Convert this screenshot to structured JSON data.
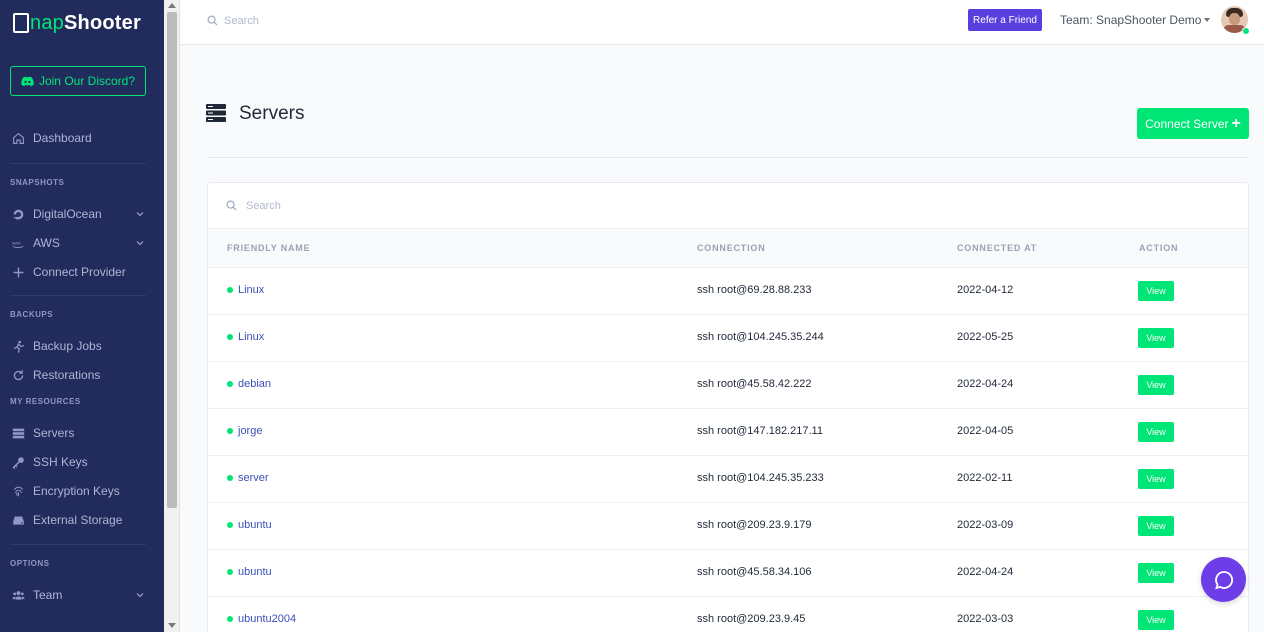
{
  "brand": {
    "logo_prefix": "S",
    "logo_snap": "nap",
    "logo_rest": "Shooter"
  },
  "sidebar": {
    "discord_label": "Join Our Discord?",
    "dashboard_label": "Dashboard",
    "sections": {
      "snapshots": "SNAPSHOTS",
      "backups": "BACKUPS",
      "resources": "MY RESOURCES",
      "options": "OPTIONS"
    },
    "items": {
      "digitalocean": "DigitalOcean",
      "aws": "AWS",
      "connect_provider": "Connect Provider",
      "backup_jobs": "Backup Jobs",
      "restorations": "Restorations",
      "servers": "Servers",
      "ssh_keys": "SSH Keys",
      "encryption_keys": "Encryption Keys",
      "external_storage": "External Storage",
      "team": "Team"
    }
  },
  "topbar": {
    "search_placeholder": "Search",
    "refer_label": "Refer a Friend",
    "team_label": "Team: SnapShooter Demo"
  },
  "page": {
    "title": "Servers",
    "connect_label": "Connect Server",
    "table_search_placeholder": "Search",
    "columns": {
      "name": "FRIENDLY NAME",
      "connection": "CONNECTION",
      "connected_at": "CONNECTED AT",
      "action": "ACTION"
    },
    "view_label": "View",
    "rows": [
      {
        "name": "Linux",
        "connection": "ssh root@69.28.88.233",
        "connected_at": "2022-04-12"
      },
      {
        "name": "Linux",
        "connection": "ssh root@104.245.35.244",
        "connected_at": "2022-05-25"
      },
      {
        "name": "debian",
        "connection": "ssh root@45.58.42.222",
        "connected_at": "2022-04-24"
      },
      {
        "name": "jorge",
        "connection": "ssh root@147.182.217.11",
        "connected_at": "2022-04-05"
      },
      {
        "name": "server",
        "connection": "ssh root@104.245.35.233",
        "connected_at": "2022-02-11"
      },
      {
        "name": "ubuntu",
        "connection": "ssh root@209.23.9.179",
        "connected_at": "2022-03-09"
      },
      {
        "name": "ubuntu",
        "connection": "ssh root@45.58.34.106",
        "connected_at": "2022-04-24"
      },
      {
        "name": "ubuntu2004",
        "connection": "ssh root@209.23.9.45",
        "connected_at": "2022-03-03"
      }
    ]
  },
  "colors": {
    "sidebar_bg": "#212b5c",
    "accent_green": "#00e676",
    "accent_purple": "#5a3fe0"
  }
}
